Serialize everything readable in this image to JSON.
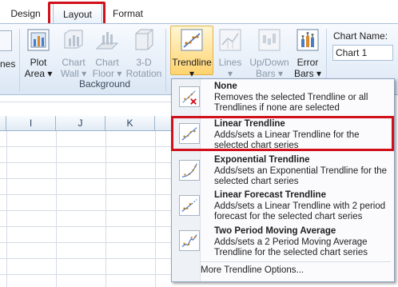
{
  "tabs": [
    {
      "label": "Design"
    },
    {
      "label": "Layout"
    },
    {
      "label": "Format"
    }
  ],
  "ribbon": {
    "partial_left_label": "nes",
    "background_group": {
      "label": "Background",
      "buttons": [
        {
          "line1": "Plot",
          "line2": "Area ▾"
        },
        {
          "line1": "Chart",
          "line2": "Wall ▾"
        },
        {
          "line1": "Chart",
          "line2": "Floor ▾"
        },
        {
          "line1": "3-D",
          "line2": "Rotation"
        }
      ]
    },
    "analysis_buttons": [
      {
        "line1": "Trendline",
        "line2": "▾"
      },
      {
        "line1": "Lines",
        "line2": "▾"
      },
      {
        "line1": "Up/Down",
        "line2": "Bars ▾"
      },
      {
        "line1": "Error",
        "line2": "Bars ▾"
      }
    ],
    "chart_name": {
      "label": "Chart Name:",
      "value": "Chart 1"
    }
  },
  "sheet": {
    "columns": [
      "I",
      "J",
      "K"
    ]
  },
  "menu": {
    "items": [
      {
        "title": "None",
        "desc": "Removes the selected Trendline or all Trendlines if none are selected"
      },
      {
        "title": "Linear Trendline",
        "desc": "Adds/sets a Linear Trendline for the selected chart series"
      },
      {
        "title": "Exponential Trendline",
        "desc": "Adds/sets an Exponential Trendline for the selected chart series"
      },
      {
        "title": "Linear Forecast Trendline",
        "desc": "Adds/sets a Linear Trendline with 2 period forecast for the selected chart series"
      },
      {
        "title": "Two Period Moving Average",
        "desc": "Adds/sets a 2 Period Moving Average Trendline for the selected chart series"
      }
    ],
    "more": "More Trendline Options..."
  },
  "colors": {
    "highlight": "#d0101a",
    "ribbon_bg": "#e4edf8",
    "selected_button": "#ffd36e"
  }
}
